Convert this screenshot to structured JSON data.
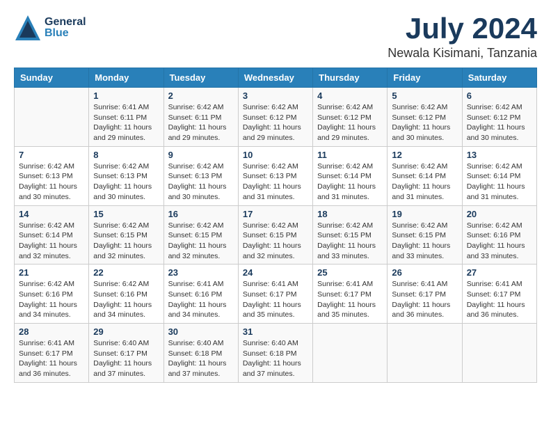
{
  "header": {
    "logo": {
      "general": "General",
      "blue": "Blue"
    },
    "month": "July 2024",
    "location": "Newala Kisimani, Tanzania"
  },
  "weekdays": [
    "Sunday",
    "Monday",
    "Tuesday",
    "Wednesday",
    "Thursday",
    "Friday",
    "Saturday"
  ],
  "weeks": [
    [
      {
        "day": "",
        "info": ""
      },
      {
        "day": "1",
        "info": "Sunrise: 6:41 AM\nSunset: 6:11 PM\nDaylight: 11 hours\nand 29 minutes."
      },
      {
        "day": "2",
        "info": "Sunrise: 6:42 AM\nSunset: 6:11 PM\nDaylight: 11 hours\nand 29 minutes."
      },
      {
        "day": "3",
        "info": "Sunrise: 6:42 AM\nSunset: 6:12 PM\nDaylight: 11 hours\nand 29 minutes."
      },
      {
        "day": "4",
        "info": "Sunrise: 6:42 AM\nSunset: 6:12 PM\nDaylight: 11 hours\nand 29 minutes."
      },
      {
        "day": "5",
        "info": "Sunrise: 6:42 AM\nSunset: 6:12 PM\nDaylight: 11 hours\nand 30 minutes."
      },
      {
        "day": "6",
        "info": "Sunrise: 6:42 AM\nSunset: 6:12 PM\nDaylight: 11 hours\nand 30 minutes."
      }
    ],
    [
      {
        "day": "7",
        "info": "Sunrise: 6:42 AM\nSunset: 6:13 PM\nDaylight: 11 hours\nand 30 minutes."
      },
      {
        "day": "8",
        "info": "Sunrise: 6:42 AM\nSunset: 6:13 PM\nDaylight: 11 hours\nand 30 minutes."
      },
      {
        "day": "9",
        "info": "Sunrise: 6:42 AM\nSunset: 6:13 PM\nDaylight: 11 hours\nand 30 minutes."
      },
      {
        "day": "10",
        "info": "Sunrise: 6:42 AM\nSunset: 6:13 PM\nDaylight: 11 hours\nand 31 minutes."
      },
      {
        "day": "11",
        "info": "Sunrise: 6:42 AM\nSunset: 6:14 PM\nDaylight: 11 hours\nand 31 minutes."
      },
      {
        "day": "12",
        "info": "Sunrise: 6:42 AM\nSunset: 6:14 PM\nDaylight: 11 hours\nand 31 minutes."
      },
      {
        "day": "13",
        "info": "Sunrise: 6:42 AM\nSunset: 6:14 PM\nDaylight: 11 hours\nand 31 minutes."
      }
    ],
    [
      {
        "day": "14",
        "info": "Sunrise: 6:42 AM\nSunset: 6:14 PM\nDaylight: 11 hours\nand 32 minutes."
      },
      {
        "day": "15",
        "info": "Sunrise: 6:42 AM\nSunset: 6:15 PM\nDaylight: 11 hours\nand 32 minutes."
      },
      {
        "day": "16",
        "info": "Sunrise: 6:42 AM\nSunset: 6:15 PM\nDaylight: 11 hours\nand 32 minutes."
      },
      {
        "day": "17",
        "info": "Sunrise: 6:42 AM\nSunset: 6:15 PM\nDaylight: 11 hours\nand 32 minutes."
      },
      {
        "day": "18",
        "info": "Sunrise: 6:42 AM\nSunset: 6:15 PM\nDaylight: 11 hours\nand 33 minutes."
      },
      {
        "day": "19",
        "info": "Sunrise: 6:42 AM\nSunset: 6:15 PM\nDaylight: 11 hours\nand 33 minutes."
      },
      {
        "day": "20",
        "info": "Sunrise: 6:42 AM\nSunset: 6:16 PM\nDaylight: 11 hours\nand 33 minutes."
      }
    ],
    [
      {
        "day": "21",
        "info": "Sunrise: 6:42 AM\nSunset: 6:16 PM\nDaylight: 11 hours\nand 34 minutes."
      },
      {
        "day": "22",
        "info": "Sunrise: 6:42 AM\nSunset: 6:16 PM\nDaylight: 11 hours\nand 34 minutes."
      },
      {
        "day": "23",
        "info": "Sunrise: 6:41 AM\nSunset: 6:16 PM\nDaylight: 11 hours\nand 34 minutes."
      },
      {
        "day": "24",
        "info": "Sunrise: 6:41 AM\nSunset: 6:17 PM\nDaylight: 11 hours\nand 35 minutes."
      },
      {
        "day": "25",
        "info": "Sunrise: 6:41 AM\nSunset: 6:17 PM\nDaylight: 11 hours\nand 35 minutes."
      },
      {
        "day": "26",
        "info": "Sunrise: 6:41 AM\nSunset: 6:17 PM\nDaylight: 11 hours\nand 36 minutes."
      },
      {
        "day": "27",
        "info": "Sunrise: 6:41 AM\nSunset: 6:17 PM\nDaylight: 11 hours\nand 36 minutes."
      }
    ],
    [
      {
        "day": "28",
        "info": "Sunrise: 6:41 AM\nSunset: 6:17 PM\nDaylight: 11 hours\nand 36 minutes."
      },
      {
        "day": "29",
        "info": "Sunrise: 6:40 AM\nSunset: 6:17 PM\nDaylight: 11 hours\nand 37 minutes."
      },
      {
        "day": "30",
        "info": "Sunrise: 6:40 AM\nSunset: 6:18 PM\nDaylight: 11 hours\nand 37 minutes."
      },
      {
        "day": "31",
        "info": "Sunrise: 6:40 AM\nSunset: 6:18 PM\nDaylight: 11 hours\nand 37 minutes."
      },
      {
        "day": "",
        "info": ""
      },
      {
        "day": "",
        "info": ""
      },
      {
        "day": "",
        "info": ""
      }
    ]
  ]
}
